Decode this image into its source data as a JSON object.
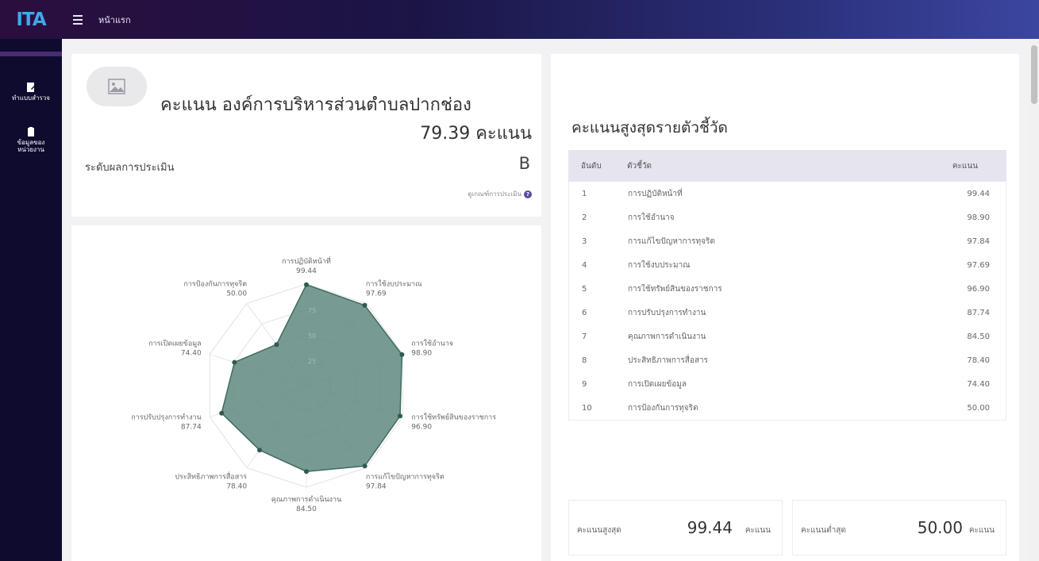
{
  "app": {
    "logo": "ITA",
    "page_tab": "หน้าแรก"
  },
  "sidebar": {
    "items": [
      {
        "label_line1": "ทำแบบสำรวจ",
        "label_line2": "",
        "icon": "form-edit-icon"
      },
      {
        "label_line1": "ข้อมูลของ",
        "label_line2": "หน่วยงาน",
        "icon": "clipboard-icon"
      }
    ]
  },
  "score_card": {
    "title": "คะแนน องค์การบริหารส่วนตำบลปากช่อง",
    "score_text": "79.39 คะแนน",
    "eval_label": "ระดับผลการประเมิน",
    "grade": "B",
    "criteria_link": "ดูเกณฑ์การประเมิน"
  },
  "radar": {
    "axes": [
      {
        "label": "การปฏิบัติหน้าที่",
        "value": 99.44,
        "value_text": "99.44"
      },
      {
        "label": "การใช้งบประมาณ",
        "value": 97.69,
        "value_text": "97.69"
      },
      {
        "label": "การใช้อำนาจ",
        "value": 98.9,
        "value_text": "98.90"
      },
      {
        "label": "การใช้ทรัพย์สินของราชการ",
        "value": 96.9,
        "value_text": "96.90"
      },
      {
        "label": "การแก้ไขปัญหาการทุจริต",
        "value": 97.84,
        "value_text": "97.84"
      },
      {
        "label": "คุณภาพการดำเนินงาน",
        "value": 84.5,
        "value_text": "84.50"
      },
      {
        "label": "ประสิทธิภาพการสื่อสาร",
        "value": 78.4,
        "value_text": "78.40"
      },
      {
        "label": "การปรับปรุงการทำงาน",
        "value": 87.74,
        "value_text": "87.74"
      },
      {
        "label": "การเปิดเผยข้อมูล",
        "value": 74.4,
        "value_text": "74.40"
      },
      {
        "label": "การป้องกันการทุจริต",
        "value": 50.0,
        "value_text": "50.00"
      }
    ],
    "ring_labels": [
      "25",
      "50",
      "75"
    ],
    "fill_color": "#5f8a80"
  },
  "top_table": {
    "title": "คะแนนสูงสุดรายตัวชี้วัด",
    "headers": {
      "rank": "อันดับ",
      "indicator": "ตัวชี้วัด",
      "score": "คะแนน"
    },
    "rows": [
      {
        "rank": "1",
        "indicator": "การปฏิบัติหน้าที่",
        "score": "99.44"
      },
      {
        "rank": "2",
        "indicator": "การใช้อำนาจ",
        "score": "98.90"
      },
      {
        "rank": "3",
        "indicator": "การแก้ไขปัญหาการทุจริต",
        "score": "97.84"
      },
      {
        "rank": "4",
        "indicator": "การใช้งบประมาณ",
        "score": "97.69"
      },
      {
        "rank": "5",
        "indicator": "การใช้ทรัพย์สินของราชการ",
        "score": "96.90"
      },
      {
        "rank": "6",
        "indicator": "การปรับปรุงการทำงาน",
        "score": "87.74"
      },
      {
        "rank": "7",
        "indicator": "คุณภาพการดำเนินงาน",
        "score": "84.50"
      },
      {
        "rank": "8",
        "indicator": "ประสิทธิภาพการสื่อสาร",
        "score": "78.40"
      },
      {
        "rank": "9",
        "indicator": "การเปิดเผยข้อมูล",
        "score": "74.40"
      },
      {
        "rank": "10",
        "indicator": "การป้องกันการทุจริต",
        "score": "50.00"
      }
    ]
  },
  "stats": {
    "max": {
      "label": "คะแนนสูงสุด",
      "value": "99.44",
      "unit": "คะแนน"
    },
    "min": {
      "label": "คะแนนต่ำสุด",
      "value": "50.00",
      "unit": "คะแนน"
    }
  }
}
